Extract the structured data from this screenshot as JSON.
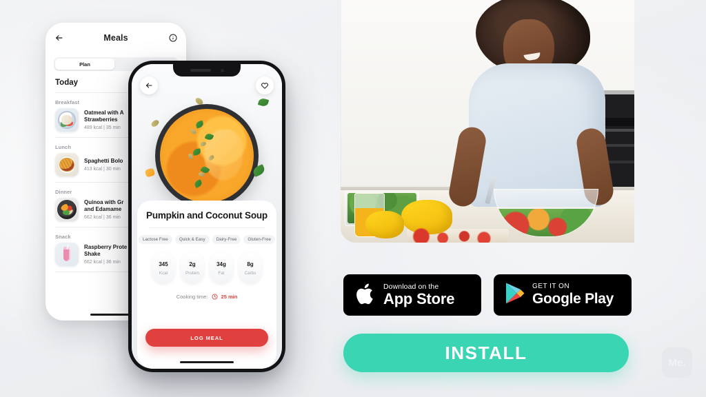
{
  "background_color": "#eff0f2",
  "meals_phone": {
    "header": {
      "back_icon": "arrow-left-icon",
      "title": "Meals",
      "info_icon": "info-circle-icon"
    },
    "segmented_tab": {
      "label": "Plan"
    },
    "day_heading": "Today",
    "sections": [
      {
        "label": "Breakfast",
        "meal": {
          "name": "Oatmeal with Apple and Strawberries",
          "name_line1": "Oatmeal with A",
          "name_line2": "Strawberries",
          "calories": "489 kcal",
          "time": "35 min",
          "separator": "|",
          "thumb": "oatmeal-thumb"
        }
      },
      {
        "label": "Lunch",
        "meal": {
          "name": "Spaghetti Bolognese",
          "name_line1": "Spaghetti Bolo",
          "name_line2": "",
          "calories": "413 kcal",
          "time": "30 min",
          "separator": "|",
          "thumb": "spaghetti-thumb"
        }
      },
      {
        "label": "Dinner",
        "meal": {
          "name": "Quinoa with Greens and Edamame Beans",
          "name_line1": "Quinoa with Gr",
          "name_line2": "and Edamame",
          "calories": "662 kcal",
          "time": "36 min",
          "separator": "|",
          "thumb": "quinoa-thumb"
        }
      },
      {
        "label": "Snack",
        "meal": {
          "name": "Raspberry Protein Shake",
          "name_line1": "Raspberry Prote",
          "name_line2": "Shake",
          "calories": "662 kcal",
          "time": "36 min",
          "separator": "|",
          "thumb": "shake-thumb"
        }
      }
    ]
  },
  "recipe_phone": {
    "back_icon": "arrow-left-icon",
    "favorite_icon": "heart-icon",
    "hero_image": "pumpkin-soup-photo",
    "title": "Pumpkin and Coconut Soup",
    "tags": [
      "Lactose Free",
      "Quick & Easy",
      "Dairy-Free",
      "Gluten-Free"
    ],
    "nutrition": [
      {
        "value": "345",
        "label": "Kcal"
      },
      {
        "value": "2g",
        "label": "Protein"
      },
      {
        "value": "34g",
        "label": "Fat"
      },
      {
        "value": "8g",
        "label": "Carbs"
      }
    ],
    "cooking_time_label": "Cooking time:",
    "cooking_time_value": "25 min",
    "cooking_time_icon": "clock-icon",
    "cta_label": "LOG MEAL",
    "cta_color": "#e0413f"
  },
  "photo": {
    "alt": "woman-cooking-salad-in-kitchen"
  },
  "store_badges": [
    {
      "icon": "apple-logo-icon",
      "small_text": "Download on the",
      "big_text": "App Store"
    },
    {
      "icon": "google-play-icon",
      "small_text": "GET IT ON",
      "big_text": "Google Play"
    }
  ],
  "install": {
    "label": "INSTALL",
    "color": "#3ad6b4"
  },
  "watermark": {
    "label": "Me."
  }
}
